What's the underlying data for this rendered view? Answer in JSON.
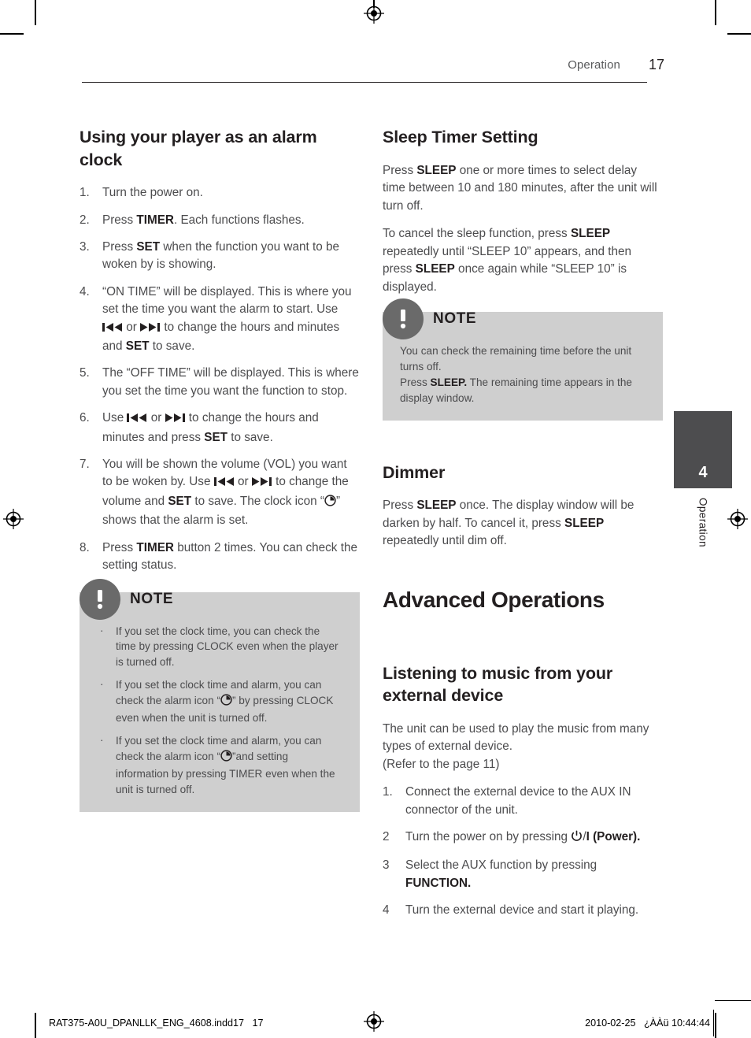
{
  "header": {
    "section": "Operation",
    "page_number": "17"
  },
  "left_column": {
    "title": "Using your player as an alarm clock",
    "steps": [
      {
        "num": "1.",
        "html": "Turn the power on."
      },
      {
        "num": "2.",
        "html": "Press <b>TIMER</b>. Each functions flashes."
      },
      {
        "num": "3.",
        "html": "Press <b>SET</b> when the function you want to be woken by is showing."
      },
      {
        "num": "4.",
        "html": "“ON TIME” will be displayed. This is where you set the time you want the alarm to start. Use [SKIP-BACK] or [SKIP-FWD] to change the hours and minutes and <b>SET</b> to save."
      },
      {
        "num": "5.",
        "html": "The “OFF TIME” will be displayed. This is where you set the time you want the function to stop."
      },
      {
        "num": "6.",
        "html": "Use [SKIP-BACK] or [SKIP-FWD] to change the hours and minutes and press <b>SET</b> to save."
      },
      {
        "num": "7.",
        "html": "You will be shown the volume (VOL) you want to be woken by. Use [SKIP-BACK] or [SKIP-FWD] to change the volume and <b>SET</b> to save. The clock icon “[CLOCK]” shows that the alarm is set."
      },
      {
        "num": "8.",
        "html": "Press <b>TIMER</b> button 2 times. You can check the setting status."
      }
    ],
    "note": {
      "label": "NOTE",
      "bullets": [
        "If you set the clock time, you can check the time by pressing CLOCK even when the player is turned off.",
        "If you set the clock time and alarm, you can check the alarm icon “[CLOCK]” by pressing CLOCK even when the unit is turned off.",
        "If you set the clock time and alarm, you can check the alarm icon “[CLOCK]”and setting information by pressing TIMER even when the unit is turned off."
      ]
    }
  },
  "right_column": {
    "sleep_timer": {
      "title": "Sleep Timer Setting",
      "paragraphs": [
        "Press <b>SLEEP</b> one or more times to select delay time between 10 and 180 minutes, after the unit will turn off.",
        "To cancel the sleep function, press <b>SLEEP</b> repeatedly until “SLEEP 10” appears, and then press <b>SLEEP</b> once again while “SLEEP 10” is displayed."
      ],
      "note": {
        "label": "NOTE",
        "body": "You can check the remaining time before the unit turns off.<br>Press <b>SLEEP.</b> The remaining time appears in the display window."
      }
    },
    "dimmer": {
      "title": "Dimmer",
      "paragraphs": [
        "Press <b>SLEEP</b> once. The display window will be darken by half. To cancel it, press <b>SLEEP</b> repeatedly until dim off."
      ]
    },
    "advanced_operations": {
      "title": "Advanced Operations",
      "listening": {
        "title": "Listening to music from your external device",
        "intro": "The unit can be used to play the music from many types of external device.<br>(Refer to the page 11)",
        "steps": [
          {
            "num": "1.",
            "html": "Connect the external device to the AUX IN connector of the unit."
          },
          {
            "num": "2",
            "html": "Turn the power on by pressing [POWER]/<b>I</b> <b>(Power).</b>"
          },
          {
            "num": "3",
            "html": "Select the AUX function by pressing <b>FUNCTION.</b>"
          },
          {
            "num": "4",
            "html": "Turn the external device and start it playing."
          }
        ]
      }
    }
  },
  "side_tab": {
    "number": "4",
    "label": "Operation"
  },
  "footer": {
    "left": "RAT375-A0U_DPANLLK_ENG_4608.indd17   17",
    "right": "2010-02-25   ¿ÀÀü 10:44:44"
  },
  "colors": {
    "note_background": "#cfcfcf",
    "note_badge": "#6a6a6a",
    "side_tab": "#4d4d4f",
    "body_text": "#4c4c4e",
    "heading_text": "#231f20"
  }
}
